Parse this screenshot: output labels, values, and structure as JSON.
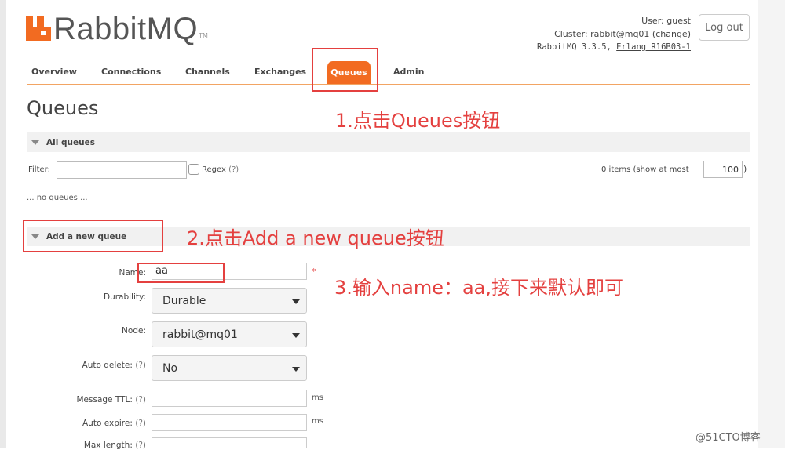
{
  "header": {
    "logo_text": "RabbitMQ",
    "logo_tm": "TM",
    "user_label": "User:",
    "user": "guest",
    "cluster_label": "Cluster:",
    "cluster": "rabbit@mq01",
    "change_link": "change",
    "version": "RabbitMQ 3.3.5,",
    "erlang_link": "Erlang R16B03-1",
    "logout_label": "Log out"
  },
  "nav": {
    "overview": "Overview",
    "connections": "Connections",
    "channels": "Channels",
    "exchanges": "Exchanges",
    "queues": "Queues",
    "admin": "Admin",
    "active": "Queues"
  },
  "page_title": "Queues",
  "all_queues": {
    "section_label": "All queues",
    "filter_label": "Filter:",
    "filter_value": "",
    "regex_label": "Regex",
    "regex_help": "(?)",
    "items_text": "0 items (show at most",
    "items_value": "100",
    "items_close": ")",
    "empty_text": "... no queues ..."
  },
  "add_queue": {
    "section_label": "Add a new queue",
    "name_label": "Name:",
    "name_value": "aa",
    "required_mark": "*",
    "durability_label": "Durability:",
    "durability_value": "Durable",
    "node_label": "Node:",
    "node_value": "rabbit@mq01",
    "auto_delete_label": "Auto delete:",
    "auto_delete_help": "(?)",
    "auto_delete_value": "No",
    "message_ttl_label": "Message TTL:",
    "message_ttl_help": "(?)",
    "message_ttl_unit": "ms",
    "auto_expire_label": "Auto expire:",
    "auto_expire_help": "(?)",
    "auto_expire_unit": "ms",
    "max_length_label": "Max length:",
    "max_length_help": "(?)"
  },
  "annotations": {
    "step1": "1.点击Queues按钮",
    "step2": "2.点击Add a new queue按钮",
    "step3": "3.输入name：aa,接下来默认即可",
    "color": "#e4403f"
  },
  "watermark": "@51CTO博客",
  "colors": {
    "accent": "#f26b21",
    "nav_underline": "#f2a463"
  }
}
